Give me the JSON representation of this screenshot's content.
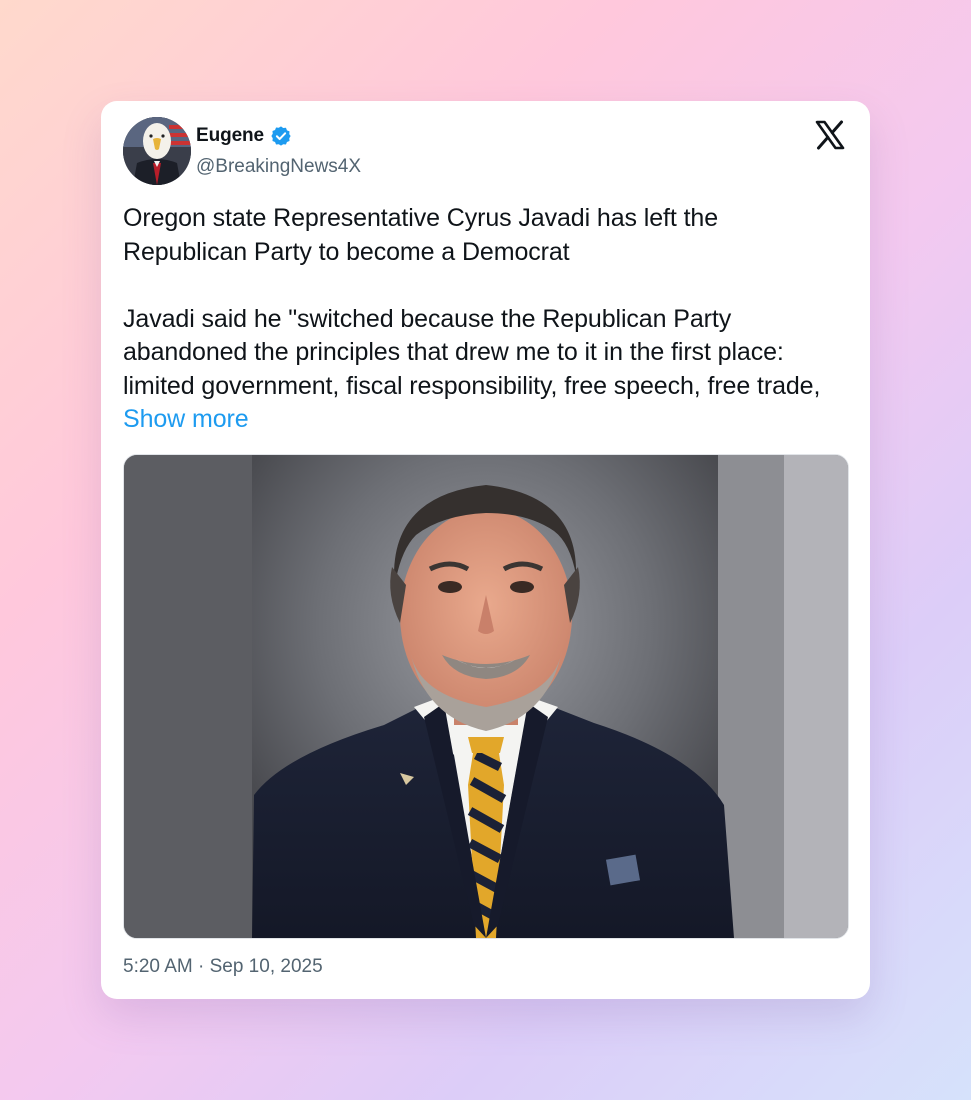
{
  "author": {
    "name": "Eugene",
    "handle": "@BreakingNews4X",
    "verified": true,
    "avatar_icon": "eagle-avatar"
  },
  "brand_icon": "x-logo-icon",
  "tweet": {
    "paragraph_1": "Oregon state Representative Cyrus Javadi has left the Republican Party to become a Democrat",
    "paragraph_2": "Javadi said he \"switched because the Republican Party abandoned the principles that drew me to it in the first place: limited government, fiscal responsibility, free speech, free trade, ",
    "show_more": "Show more"
  },
  "media": {
    "subject": "portrait-photo"
  },
  "timestamp": "5:20 AM · Sep 10, 2025",
  "colors": {
    "link": "#1d9bf0",
    "verified_badge": "#1d9bf0",
    "secondary_text": "#536471",
    "primary_text": "#0f1419"
  }
}
